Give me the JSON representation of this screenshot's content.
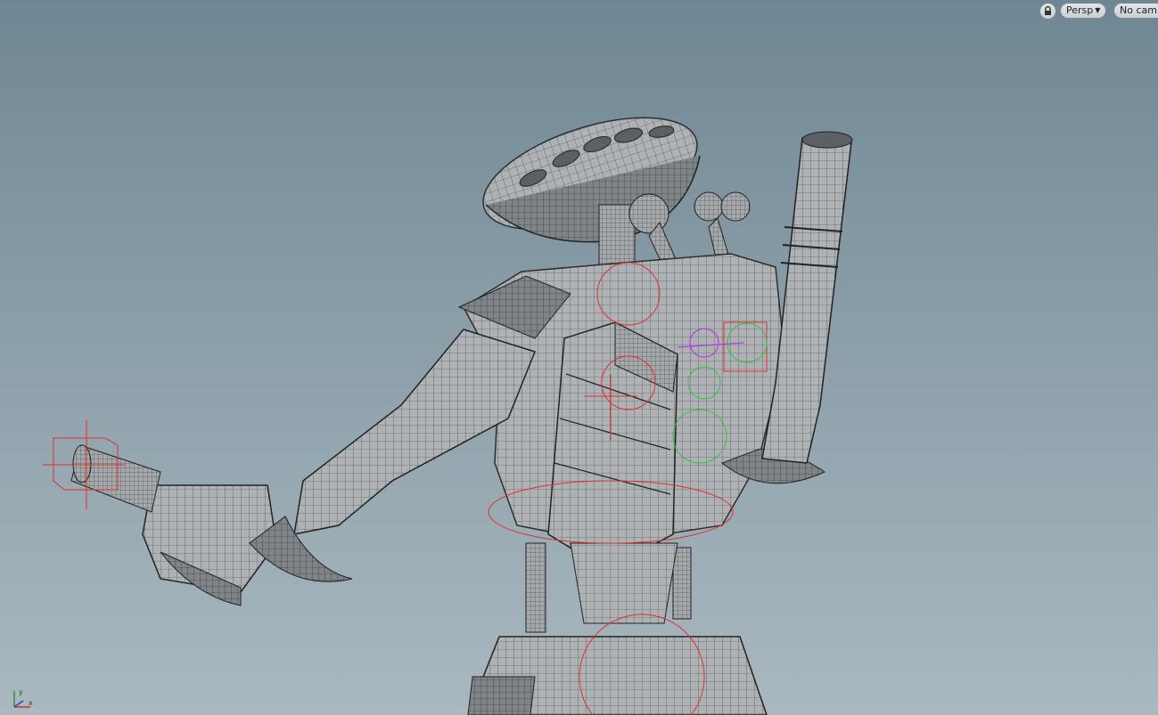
{
  "viewport": {
    "view_menu": {
      "label": "Persp"
    },
    "camera_menu": {
      "label": "No cam"
    },
    "lock_icon": "lock-icon",
    "axis_gizmo": {
      "x_label": "x",
      "y_label": "y",
      "x_color": "#d03030",
      "y_color": "#3a8a3a",
      "z_color": "#3040c0"
    }
  },
  "colors": {
    "bg_top": "#6f8794",
    "bg_bottom": "#aab8bf",
    "mesh_fill": "#a9adb0",
    "wire": "#3a3d40",
    "handle_red": "#e03030",
    "handle_green": "#38c040",
    "handle_purple": "#b040e0"
  }
}
